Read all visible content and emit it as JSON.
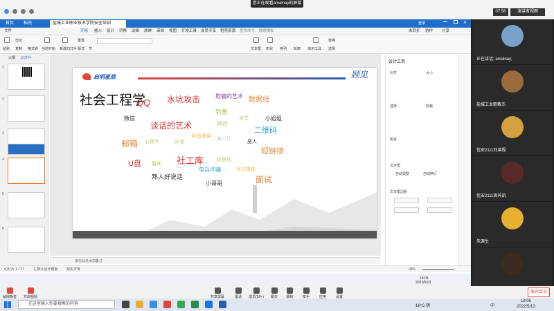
{
  "meeting": {
    "banner": "您正在观看amalnay的屏幕",
    "time": "07:58",
    "speaker_view": "演讲者视图"
  },
  "wps": {
    "tabs": [
      "首页",
      "稻壳",
      "盐城工业职业技术学院安全培训"
    ],
    "window_actions": "登录",
    "menus": [
      "文件",
      "开始",
      "插入",
      "设计",
      "切换",
      "动画",
      "放映",
      "审阅",
      "视图",
      "开发工具",
      "会员专享",
      "稻壳资源",
      "查找命令、搜索模板"
    ],
    "menu_right": [
      "未同步",
      "协作",
      "分享"
    ],
    "ribbon": {
      "paste": "粘贴",
      "cut": "剪切",
      "copy": "复制",
      "format": "格式刷",
      "from_current": "当前开始",
      "new_slide": "新建幻灯片",
      "layout": "版式",
      "section": "节",
      "reset": "重置",
      "text_box": "文本框",
      "shapes": "形状",
      "arrange": "排列",
      "outline": "轮廓",
      "presenter": "演示工具",
      "replace": "替换",
      "select": "选择"
    },
    "panel_tabs": [
      "大纲",
      "幻灯片"
    ],
    "slide_numbers": [
      "1",
      "2",
      "3",
      "4",
      "5",
      "6"
    ],
    "slide": {
      "logo": "启明星辰",
      "gujian": "顾见",
      "title": "社会工程学",
      "words": [
        {
          "t": "QQ",
          "c": "#d9332b",
          "s": 13
        },
        {
          "t": "水坑攻击",
          "c": "#d9332b",
          "s": 12
        },
        {
          "t": "欺骗的艺术",
          "c": "#8b4a9c",
          "s": 8
        },
        {
          "t": "数据线",
          "c": "#e0883a",
          "s": 10
        },
        {
          "t": "钓鱼",
          "c": "#9ec44b",
          "s": 9
        },
        {
          "t": "微信",
          "c": "#333333",
          "s": 8
        },
        {
          "t": "谈话的艺术",
          "c": "#d9332b",
          "s": 12
        },
        {
          "t": "网络",
          "c": "#b8d27a",
          "s": 8
        },
        {
          "t": "食堂",
          "c": "#b8d27a",
          "s": 7
        },
        {
          "t": "小姐姐",
          "c": "#333333",
          "s": 8
        },
        {
          "t": "二维码",
          "c": "#3a9bd5",
          "s": 11
        },
        {
          "t": "邮箱",
          "c": "#e0883a",
          "s": 12
        },
        {
          "t": "心理学",
          "c": "#b8d27a",
          "s": 7
        },
        {
          "t": "外卖",
          "c": "#b8d27a",
          "s": 8
        },
        {
          "t": "钓鱼邮件",
          "c": "#f0b84a",
          "s": 7
        },
        {
          "t": "美人计",
          "c": "#c9c9c9",
          "s": 7
        },
        {
          "t": "恶人",
          "c": "#333333",
          "s": 7
        },
        {
          "t": "短链接",
          "c": "#e0883a",
          "s": 11
        },
        {
          "t": "U盘",
          "c": "#d9332b",
          "s": 11
        },
        {
          "t": "喜欢",
          "c": "#9ec44b",
          "s": 7
        },
        {
          "t": "社工库",
          "c": "#d9332b",
          "s": 13
        },
        {
          "t": "数据线",
          "c": "#b8d27a",
          "s": 7
        },
        {
          "t": "电话诈骗",
          "c": "#3a9bd5",
          "s": 8
        },
        {
          "t": "社交媒体",
          "c": "#f0b84a",
          "s": 7
        },
        {
          "t": "熟人好说话",
          "c": "#333333",
          "s": 9
        },
        {
          "t": "小哥哥",
          "c": "#333333",
          "s": 8
        },
        {
          "t": "面试",
          "c": "#e0883a",
          "s": 12
        }
      ]
    },
    "notes": "单击此处添加备注",
    "status": {
      "slide": "幻灯片 3 / 27",
      "theme": "1_默认设计模板",
      "font": "缺失字体",
      "zoom": "99%"
    },
    "right_panel": {
      "title": "设计工具",
      "align": "对齐",
      "size": "大小",
      "select": "选择",
      "clip": "剪裁",
      "combine": "组合",
      "text_box": "文本框",
      "auto_fit": "自动调整",
      "wrap": "自动换行",
      "text_margin": "文本框边距"
    }
  },
  "participants": [
    {
      "name": "正在讲话: amalnay;",
      "color": "#7aa2c8"
    },
    {
      "name": "盐城工业职教杰",
      "color": "#9a6a3a"
    },
    {
      "name": "信安2111刘曾程",
      "color": "#d4a040"
    },
    {
      "name": "信安2111周梓凯",
      "color": "#5a2a2a"
    },
    {
      "name": "朱源生",
      "color": "#e8b030"
    },
    {
      "name": "",
      "color": "#3a2a20"
    }
  ],
  "meeting_bar": {
    "mute": "解除静音",
    "video": "开启视频",
    "share": "共享屏幕",
    "invite": "邀请",
    "members": "成员(99+)",
    "chat": "聊天",
    "record": "录制",
    "raise": "举手",
    "apps": "应用",
    "settings": "设置",
    "leave": "离开会议"
  },
  "taskbar": {
    "search": "在这里输入你要搜索的内容",
    "weather": "16°C 阴",
    "lang": "中",
    "time": "19:05",
    "date": "2022/5/13",
    "inner_time": "19:05",
    "inner_date": "2022/5/13"
  }
}
